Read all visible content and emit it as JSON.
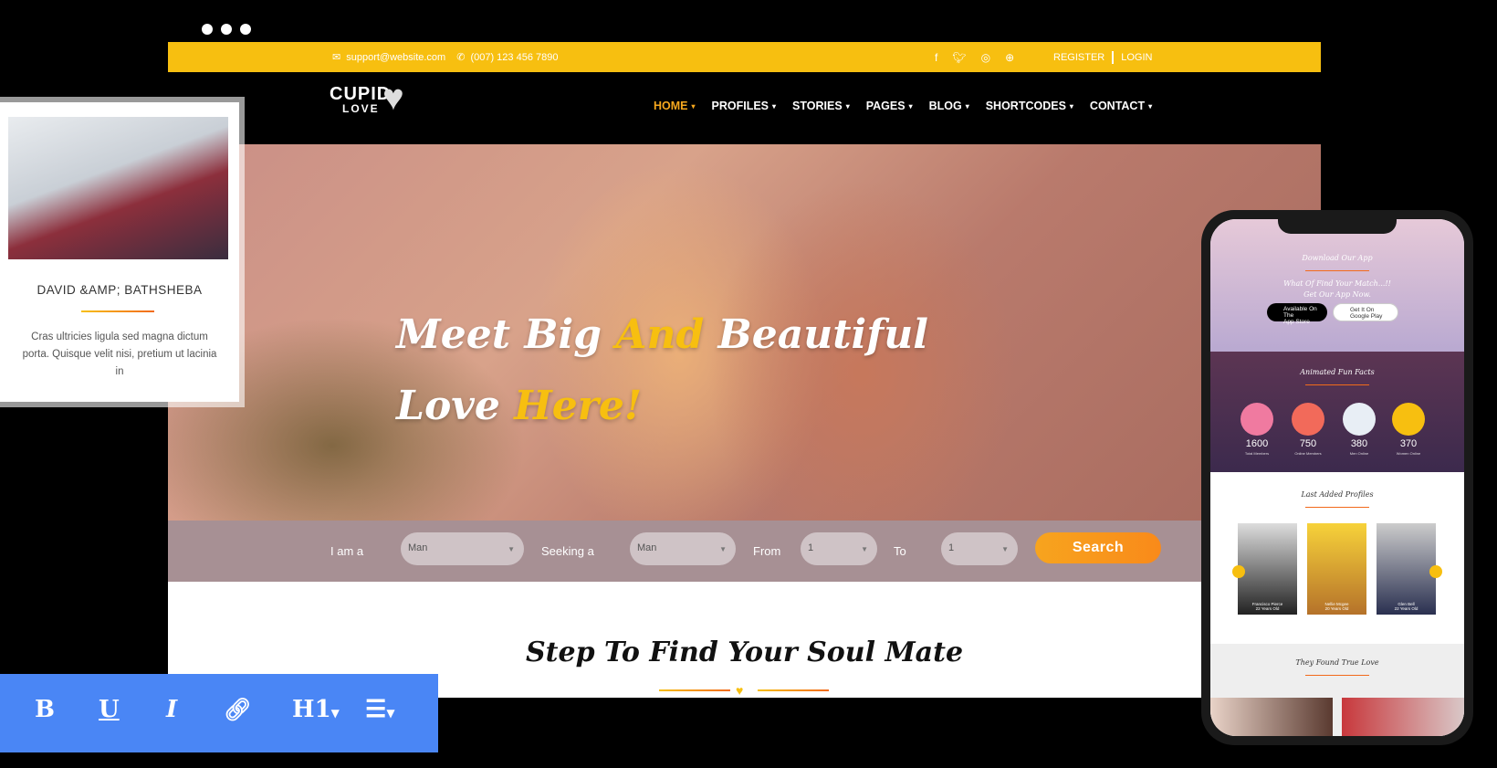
{
  "contact": {
    "email": "support@website.com",
    "phone": "(007) 123 456 7890"
  },
  "social_icons": [
    "facebook-icon",
    "twitter-icon",
    "instagram-icon",
    "dribbble-icon"
  ],
  "auth": {
    "register": "REGISTER",
    "login": "LOGIN"
  },
  "logo": {
    "line1": "CUPID",
    "line2": "LOVE"
  },
  "menu": [
    {
      "label": "HOME",
      "active": true
    },
    {
      "label": "PROFILES"
    },
    {
      "label": "STORIES"
    },
    {
      "label": "PAGES"
    },
    {
      "label": "BLOG"
    },
    {
      "label": "SHORTCODES"
    },
    {
      "label": "CONTACT"
    }
  ],
  "hero": {
    "line1a": "Meet Big ",
    "line1b": "And",
    "line1c": " Beautiful",
    "line2a": "Love ",
    "line2b": "Here!"
  },
  "search": {
    "i_am_label": "I am a",
    "i_am_value": "Man",
    "seeking_label": "Seeking a",
    "seeking_value": "Man",
    "from_label": "From",
    "from_value": "1",
    "to_label": "To",
    "to_value": "1",
    "button": "Search"
  },
  "section": {
    "title": "Step To Find Your Soul Mate"
  },
  "card": {
    "name": "DAVID &AMP; BATHSHEBA",
    "text": "Cras ultricies ligula sed magna dictum porta. Quisque velit nisi, pretium ut lacinia in"
  },
  "toolbar": {
    "bold": "B",
    "underline": "U",
    "italic": "I",
    "heading": "H1"
  },
  "phone": {
    "app_title": "Download Our App",
    "app_tag1": "What Of Find Your Match...!!",
    "app_tag2": "Get Our App Now.",
    "apple_small": "Available On The",
    "apple_big": "App Store",
    "google_small": "Get It On",
    "google_big": "Google Play",
    "facts_title": "Animated Fun Facts",
    "facts": [
      {
        "value": "1600",
        "label": "Total Members"
      },
      {
        "value": "750",
        "label": "Online Members"
      },
      {
        "value": "380",
        "label": "Men Online"
      },
      {
        "value": "370",
        "label": "Women Online"
      }
    ],
    "profiles_title": "Last Added Profiles",
    "profiles": [
      {
        "name": "Francisco Pierce",
        "age": "22 Years Old"
      },
      {
        "name": "Nellie Mcgee",
        "age": "20 Years Old"
      },
      {
        "name": "Glen Bell",
        "age": "22 Years Old"
      }
    ],
    "love_title": "They Found True Love"
  },
  "colors": {
    "accent": "#f7bf10",
    "orange": "#f98a1a",
    "toolbar": "#4a86f5"
  }
}
